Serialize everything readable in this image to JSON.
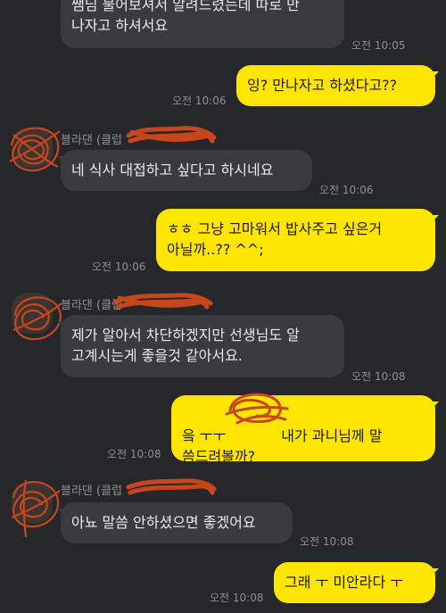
{
  "messages": [
    {
      "text": "쌤님 물어보셔서 알려드렸는데 따로 만\n나자고 하셔서요",
      "time": "오전 10:05"
    },
    {
      "text": "잉? 만나자고 하셨다고??",
      "time": "오전 10:06"
    },
    {
      "sender": "블라댄 (클럽",
      "text": "네 식사 대접하고 싶다고 하시네요",
      "time": "오전 10:06"
    },
    {
      "text": "ㅎㅎ 그냥 고마워서 밥사주고 싶은거\n아닐까..?? ^^;",
      "time": "오전 10:06"
    },
    {
      "sender": "블라댄 (클럽",
      "text": "제가 알아서 차단하겠지만 선생님도 알\n고계시는게 좋을것 같아서요.",
      "time": "오전 10:08"
    },
    {
      "text_start": "읔 ㅜㅜ",
      "text_end": "내가 과니님께 말\n씀드려볼까?",
      "time": "오전 10:08"
    },
    {
      "sender": "블라댄 (클럽",
      "text": "아뇨 말씀 안하셨으면 좋겠어요",
      "time": "오전 10:08"
    },
    {
      "text": "그래 ㅜ 미안라다 ㅜ",
      "time": "오전 10:08"
    }
  ],
  "colors": {
    "background": "#26272b",
    "incoming": "#3a3b40",
    "outgoing": "#fee500",
    "redaction": "#c8461c"
  }
}
